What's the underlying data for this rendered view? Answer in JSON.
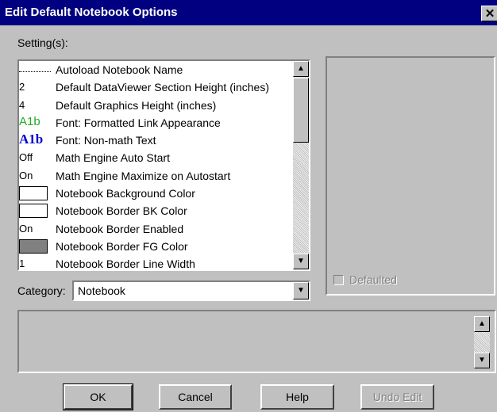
{
  "window": {
    "title": "Edit Default Notebook Options",
    "close": "✕"
  },
  "settings_label": "Setting(s):",
  "settings": [
    {
      "value": "",
      "kind": "blank",
      "name": "Autoload Notebook Name"
    },
    {
      "value": "2",
      "kind": "text",
      "name": "Default DataViewer Section Height (inches)"
    },
    {
      "value": "4",
      "kind": "text",
      "name": "Default Graphics Height (inches)"
    },
    {
      "value": "A1b",
      "kind": "green",
      "name": "Font: Formatted Link Appearance"
    },
    {
      "value": "A1b",
      "kind": "blue",
      "name": "Font: Non-math Text"
    },
    {
      "value": "Off",
      "kind": "text",
      "name": "Math Engine Auto Start"
    },
    {
      "value": "On",
      "kind": "text",
      "name": "Math Engine Maximize on Autostart"
    },
    {
      "value": "",
      "kind": "swatch-white",
      "name": "Notebook Background Color"
    },
    {
      "value": "",
      "kind": "swatch-white",
      "name": "Notebook Border BK Color"
    },
    {
      "value": "On",
      "kind": "text",
      "name": "Notebook Border Enabled"
    },
    {
      "value": "",
      "kind": "swatch-gray",
      "name": "Notebook Border FG Color"
    },
    {
      "value": "1",
      "kind": "text",
      "name": "Notebook Border Line Width"
    }
  ],
  "colors": {
    "swatch_gray": "#808080",
    "font_link": "#22aa22",
    "font_text": "#0000cc"
  },
  "category": {
    "label": "Category:",
    "value": "Notebook"
  },
  "defaulted": {
    "label": "Defaulted",
    "checked": false
  },
  "buttons": {
    "ok": "OK",
    "cancel": "Cancel",
    "help": "Help",
    "undo": "Undo Edit"
  }
}
